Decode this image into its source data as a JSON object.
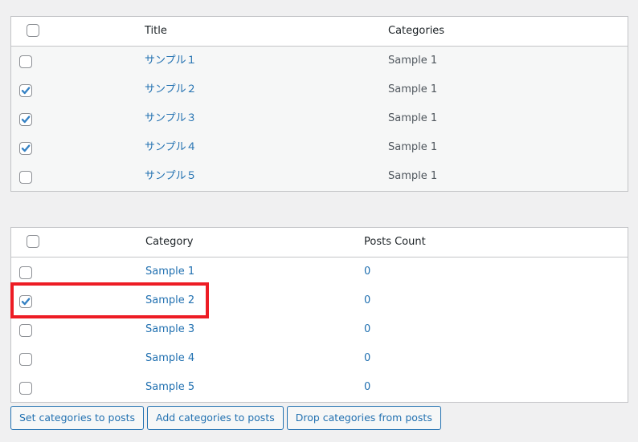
{
  "posts_table": {
    "header": {
      "title": "Title",
      "categories": "Categories",
      "select_all_checked": false
    },
    "rows": [
      {
        "title": "サンプル１",
        "categories": "Sample 1",
        "checked": false
      },
      {
        "title": "サンプル２",
        "categories": "Sample 1",
        "checked": true
      },
      {
        "title": "サンプル３",
        "categories": "Sample 1",
        "checked": true
      },
      {
        "title": "サンプル４",
        "categories": "Sample 1",
        "checked": true
      },
      {
        "title": "サンプル５",
        "categories": "Sample 1",
        "checked": false
      }
    ]
  },
  "categories_table": {
    "header": {
      "category": "Category",
      "posts_count": "Posts Count",
      "select_all_checked": false
    },
    "rows": [
      {
        "category": "Sample 1",
        "posts_count": "0",
        "checked": false
      },
      {
        "category": "Sample 2",
        "posts_count": "0",
        "checked": true
      },
      {
        "category": "Sample 3",
        "posts_count": "0",
        "checked": false
      },
      {
        "category": "Sample 4",
        "posts_count": "0",
        "checked": false
      },
      {
        "category": "Sample 5",
        "posts_count": "0",
        "checked": false
      }
    ]
  },
  "highlight": {
    "target": "categories_table.rows.1",
    "color": "#ed1c24"
  },
  "actions": {
    "set_label": "Set categories to posts",
    "add_label": "Add categories to posts",
    "drop_label": "Drop categories from posts"
  },
  "colors": {
    "link": "#2271b1",
    "check": "#3582c4",
    "border": "#c3c4c7",
    "background": "#f0f0f1"
  }
}
